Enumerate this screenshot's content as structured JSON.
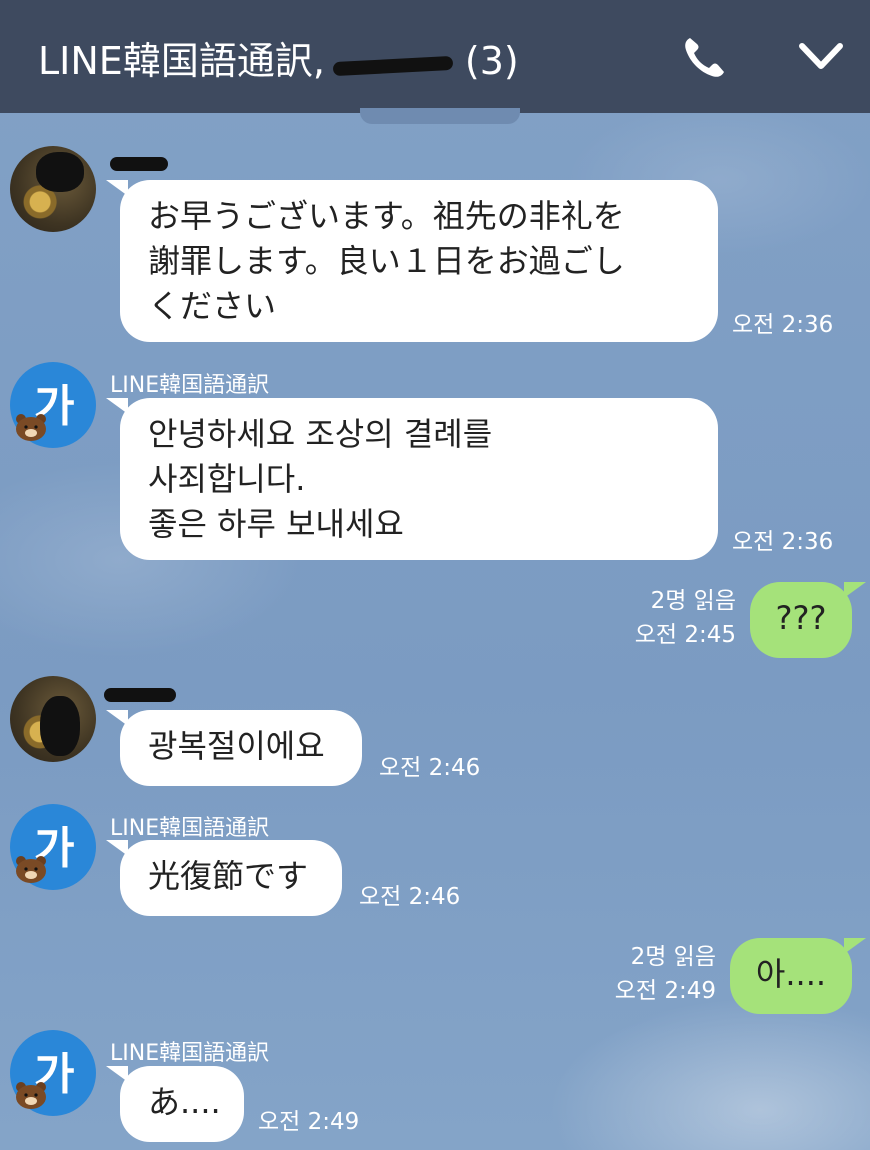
{
  "header": {
    "title_prefix": "LINE韓国語通訳,",
    "title_suffix": "(3)",
    "icons": {
      "call": "phone-icon",
      "collapse": "chevron-down-icon"
    }
  },
  "colors": {
    "header_bg": "#3e4a5f",
    "chat_bg": "#7c9cc3",
    "incoming_bubble": "#ffffff",
    "outgoing_bubble": "#a5e27a",
    "bot_avatar": "#2a87d8"
  },
  "messages": [
    {
      "sender": "",
      "lines": [
        "お早うございます。祖先の非礼を",
        "謝罪します。良い１日をお過ごし",
        "ください"
      ],
      "time": "오전 2:36"
    },
    {
      "sender": "LINE韓国語通訳",
      "avatar": "가",
      "lines": [
        "안녕하세요 조상의 결례를",
        "사죄합니다.",
        "좋은 하루 보내세요"
      ],
      "time": "오전 2:36"
    },
    {
      "text": "???",
      "read": "2명 읽음",
      "time": "오전 2:45"
    },
    {
      "sender": "",
      "lines": [
        "광복절이에요"
      ],
      "time": "오전 2:46"
    },
    {
      "sender": "LINE韓国語通訳",
      "avatar": "가",
      "lines": [
        "光復節です"
      ],
      "time": "오전 2:46"
    },
    {
      "text": "아....",
      "read": "2명 읽음",
      "time": "오전 2:49"
    },
    {
      "sender": "LINE韓国語通訳",
      "avatar": "가",
      "lines": [
        "あ...."
      ],
      "time": "오전 2:49"
    }
  ]
}
